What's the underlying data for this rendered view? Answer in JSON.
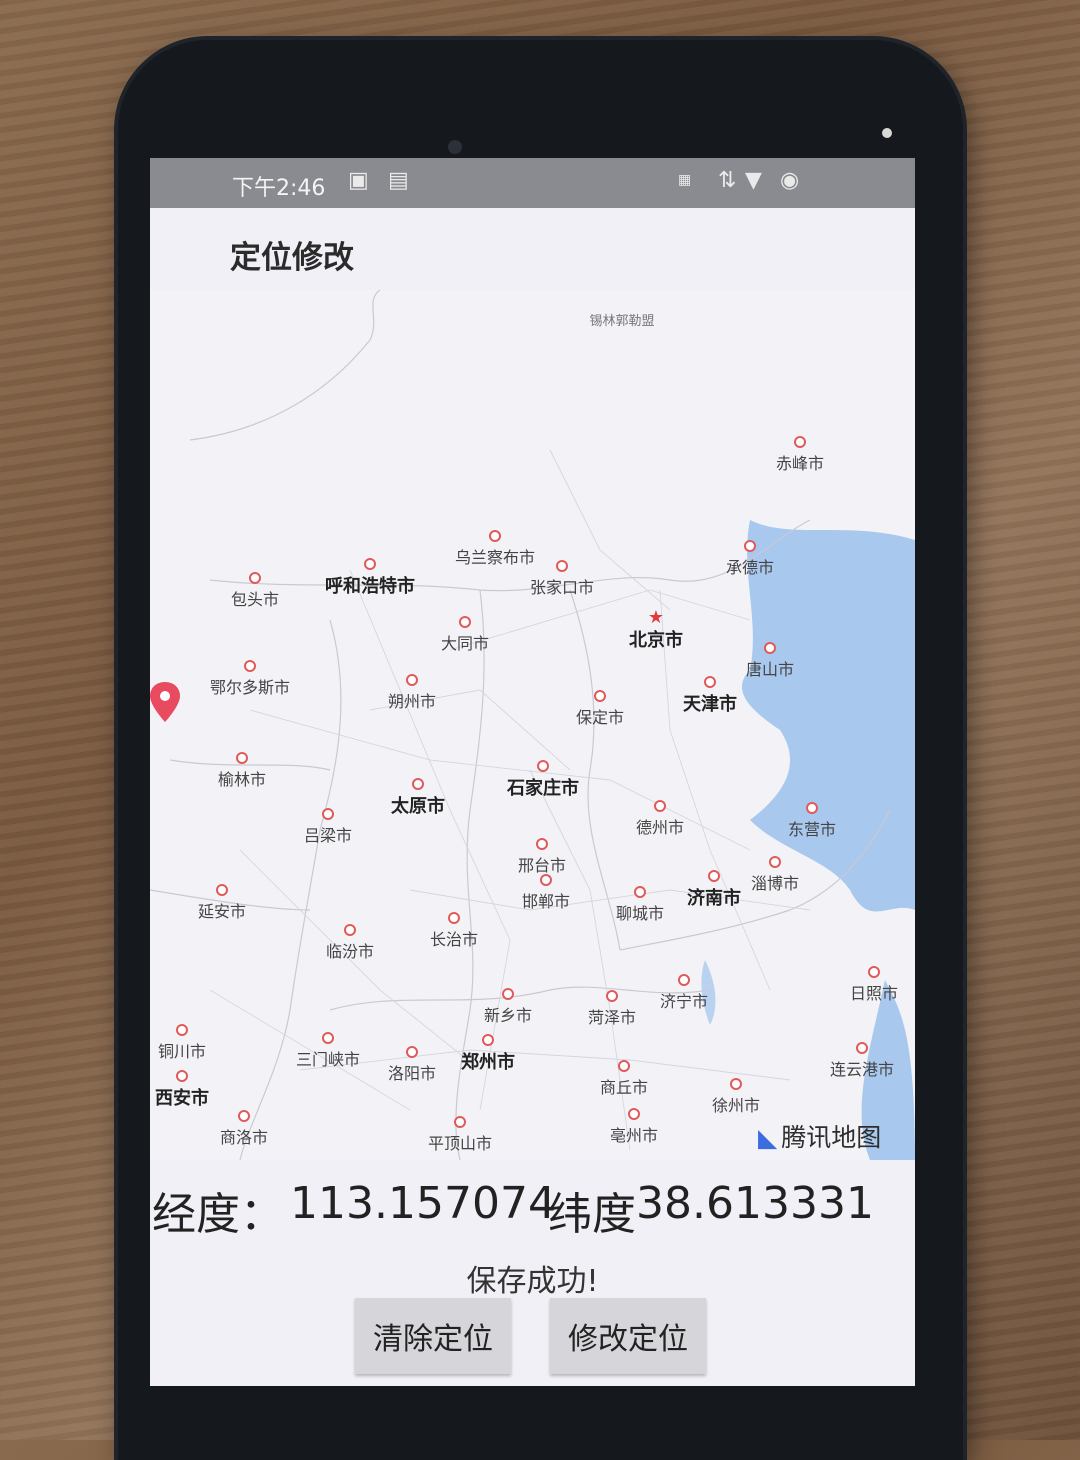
{
  "statusbar": {
    "time": "下午2:46"
  },
  "app": {
    "title": "定位修改"
  },
  "map": {
    "provider": "腾讯地图",
    "cities": [
      {
        "name": "锡林郭勒盟",
        "type": "small"
      },
      {
        "name": "赤峰市",
        "type": "normal"
      },
      {
        "name": "乌兰察布市",
        "type": "normal"
      },
      {
        "name": "呼和浩特市",
        "type": "major"
      },
      {
        "name": "包头市",
        "type": "normal"
      },
      {
        "name": "张家口市",
        "type": "normal"
      },
      {
        "name": "承德市",
        "type": "normal"
      },
      {
        "name": "大同市",
        "type": "normal"
      },
      {
        "name": "北京市",
        "type": "capital"
      },
      {
        "name": "鄂尔多斯市",
        "type": "normal"
      },
      {
        "name": "唐山市",
        "type": "normal"
      },
      {
        "name": "朔州市",
        "type": "normal"
      },
      {
        "name": "天津市",
        "type": "major"
      },
      {
        "name": "保定市",
        "type": "normal"
      },
      {
        "name": "榆林市",
        "type": "normal"
      },
      {
        "name": "石家庄市",
        "type": "major"
      },
      {
        "name": "太原市",
        "type": "major"
      },
      {
        "name": "吕梁市",
        "type": "normal"
      },
      {
        "name": "德州市",
        "type": "normal"
      },
      {
        "name": "东营市",
        "type": "normal"
      },
      {
        "name": "邢台市",
        "type": "normal"
      },
      {
        "name": "淄博市",
        "type": "normal"
      },
      {
        "name": "济南市",
        "type": "major"
      },
      {
        "name": "邯郸市",
        "type": "normal"
      },
      {
        "name": "聊城市",
        "type": "normal"
      },
      {
        "name": "延安市",
        "type": "normal"
      },
      {
        "name": "长治市",
        "type": "normal"
      },
      {
        "name": "临汾市",
        "type": "normal"
      },
      {
        "name": "济宁市",
        "type": "normal"
      },
      {
        "name": "日照市",
        "type": "normal"
      },
      {
        "name": "新乡市",
        "type": "normal"
      },
      {
        "name": "菏泽市",
        "type": "normal"
      },
      {
        "name": "铜川市",
        "type": "normal"
      },
      {
        "name": "三门峡市",
        "type": "normal"
      },
      {
        "name": "郑州市",
        "type": "major"
      },
      {
        "name": "洛阳市",
        "type": "normal"
      },
      {
        "name": "连云港市",
        "type": "normal"
      },
      {
        "name": "西安市",
        "type": "major"
      },
      {
        "name": "商丘市",
        "type": "normal"
      },
      {
        "name": "徐州市",
        "type": "normal"
      },
      {
        "name": "商洛市",
        "type": "normal"
      },
      {
        "name": "平顶山市",
        "type": "normal"
      },
      {
        "name": "亳州市",
        "type": "normal"
      }
    ]
  },
  "location": {
    "lng_label": "经度：",
    "lng": "113.157074",
    "lat_label": "纬度",
    "lat": "38.613331"
  },
  "message": "保存成功!",
  "buttons": {
    "clear": "清除定位",
    "modify": "修改定位"
  },
  "colors": {
    "accent": "#e23a3a",
    "sea": "#a9c8ee",
    "button": "#d6d6da"
  }
}
